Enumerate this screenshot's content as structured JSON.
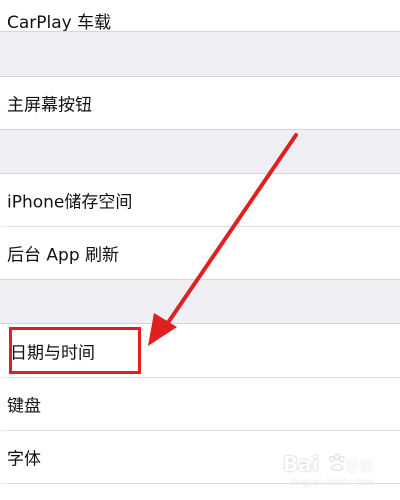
{
  "settings_list": {
    "group1": {
      "carplay_label": "CarPlay 车载"
    },
    "group2": {
      "home_button_label": "主屏幕按钮"
    },
    "group3": {
      "iphone_storage_label": "iPhone储存空间",
      "background_refresh_label": "后台 App 刷新"
    },
    "group4": {
      "date_time_label": "日期与时间",
      "keyboard_label": "键盘",
      "fonts_label": "字体"
    }
  },
  "annotation": {
    "color": "#e02020",
    "highlighted_item": "日期与时间"
  },
  "watermark": {
    "brand": "Bai",
    "brand_suffix": "经验",
    "domain": "jingyan.baidu.com"
  }
}
